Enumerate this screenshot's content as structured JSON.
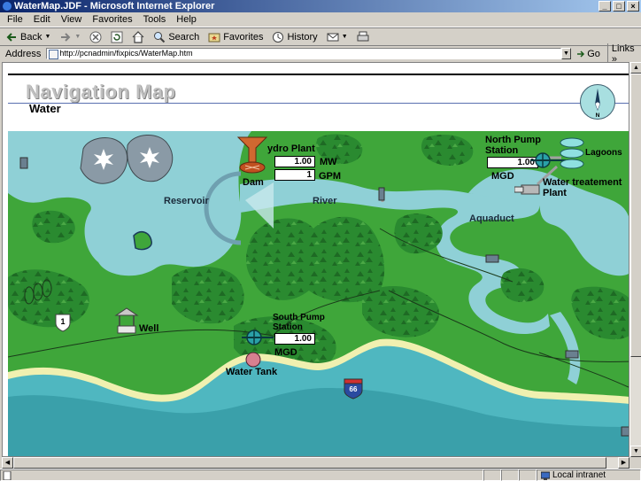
{
  "window": {
    "title": "WaterMap.JDF - Microsoft Internet Explorer",
    "minimize": "_",
    "maximize": "□",
    "close": "×"
  },
  "menu": [
    "File",
    "Edit",
    "View",
    "Favorites",
    "Tools",
    "Help"
  ],
  "toolbar": {
    "back": "Back",
    "search": "Search",
    "favorites": "Favorites",
    "history": "History"
  },
  "address": {
    "label": "Address",
    "url": "http://pcnadmin/fixpics/WaterMap.htm",
    "go": "Go",
    "links": "Links"
  },
  "page": {
    "title": "Navigation Map",
    "subtitle": "Water",
    "compass_letter": "N"
  },
  "map": {
    "hydro_plant": "ydro Plant",
    "mw_value": "1.00",
    "mw_unit": "MW",
    "gpm_value": "1",
    "gpm_unit": "GPM",
    "dam": "Dam",
    "reservoir": "Reservoir",
    "river": "River",
    "north_pump_station": "North Pump Station",
    "north_value": "1.00",
    "north_unit": "MGD",
    "lagoons": "Lagoons",
    "water_treatment": "Water treatement Plant",
    "aquaduct": "Aquaduct",
    "south_pump_station": "South Pump Station",
    "south_value": "1.00",
    "south_unit": "MGD",
    "water_tank": "Water Tank",
    "well": "Well",
    "route_1": "1",
    "route_66": "66"
  },
  "status": {
    "zone": "Local intranet"
  },
  "colors": {
    "land": "#3fa63a",
    "water": "#8fd0d6",
    "sea": "#4fb7c0",
    "forest": "#237a2a",
    "title_bar": "#0a246a"
  }
}
